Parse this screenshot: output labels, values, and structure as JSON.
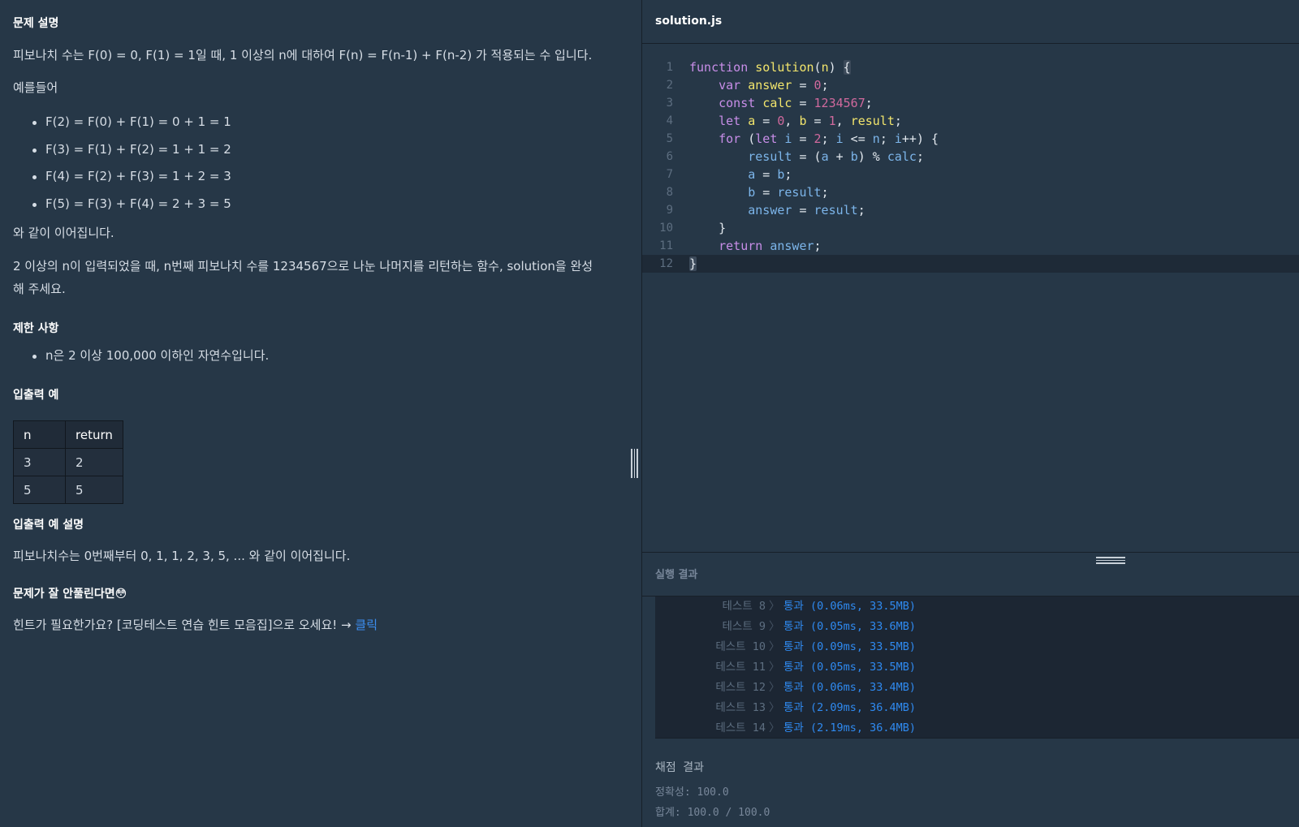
{
  "problem": {
    "heading": "문제 설명",
    "intro": "피보나치 수는 F(0) = 0, F(1) = 1일 때, 1 이상의 n에 대하여 F(n) = F(n-1) + F(n-2) 가 적용되는 수 입니다.",
    "example_label": "예를들어",
    "examples": [
      "F(2) = F(0) + F(1) = 0 + 1 = 1",
      "F(3) = F(1) + F(2) = 1 + 1 = 2",
      "F(4) = F(2) + F(3) = 1 + 2 = 3",
      "F(5) = F(3) + F(4) = 2 + 3 = 5"
    ],
    "continues": "와 같이 이어집니다.",
    "task_line1": "2 이상의 n이 입력되었을 때, n번째 피보나치 수를 1234567으로 나눈 나머지를 리턴하는 함수, solution을 완성",
    "task_line2": "해 주세요.",
    "constraints_heading": "제한 사항",
    "constraints": [
      "n은 2 이상 100,000 이하인 자연수입니다."
    ],
    "io_heading": "입출력 예",
    "io_table": {
      "headers": [
        "n",
        "return"
      ],
      "rows": [
        [
          "3",
          "2"
        ],
        [
          "5",
          "5"
        ]
      ]
    },
    "io_explain_heading": "입출력 예 설명",
    "io_explain": "피보나치수는 0번째부터 0, 1, 1, 2, 3, 5, ... 와 같이 이어집니다.",
    "help_heading": "문제가 잘 안풀린다면😳",
    "help_text": "힌트가 필요한가요? [코딩테스트 연습 힌트 모음집]으로 오세요! → ",
    "help_link": "클릭"
  },
  "editor": {
    "filename": "solution.js",
    "line_numbers": [
      "1",
      "2",
      "3",
      "4",
      "5",
      "6",
      "7",
      "8",
      "9",
      "10",
      "11",
      "12"
    ],
    "code_lines": [
      "function solution(n) {",
      "    var answer = 0;",
      "    const calc = 1234567;",
      "    let a = 0, b = 1, result;",
      "    for (let i = 2; i <= n; i++) {",
      "        result = (a + b) % calc;",
      "        a = b;",
      "        b = result;",
      "        answer = result;",
      "    }",
      "    return answer;",
      "}"
    ],
    "active_line": 12,
    "colors": {
      "keyword": "#c88ee8",
      "function_name": "#f2e56c",
      "number": "#d0699d",
      "identifier": "#7cb5ea"
    }
  },
  "results": {
    "label": "실행 결과",
    "tests": [
      {
        "name": "테스트 8",
        "arrow": "〉",
        "status": "통과 (0.06ms, 33.5MB)"
      },
      {
        "name": "테스트 9",
        "arrow": "〉",
        "status": "통과 (0.05ms, 33.6MB)"
      },
      {
        "name": "테스트 10",
        "arrow": "〉",
        "status": "통과 (0.09ms, 33.5MB)"
      },
      {
        "name": "테스트 11",
        "arrow": "〉",
        "status": "통과 (0.05ms, 33.5MB)"
      },
      {
        "name": "테스트 12",
        "arrow": "〉",
        "status": "통과 (0.06ms, 33.4MB)"
      },
      {
        "name": "테스트 13",
        "arrow": "〉",
        "status": "통과 (2.09ms, 36.4MB)"
      },
      {
        "name": "테스트 14",
        "arrow": "〉",
        "status": "통과 (2.19ms, 36.4MB)"
      }
    ],
    "grade_title": "채점 결과",
    "accuracy": "정확성: 100.0",
    "total": "합계: 100.0 / 100.0",
    "pass_color": "#2f8af0"
  }
}
